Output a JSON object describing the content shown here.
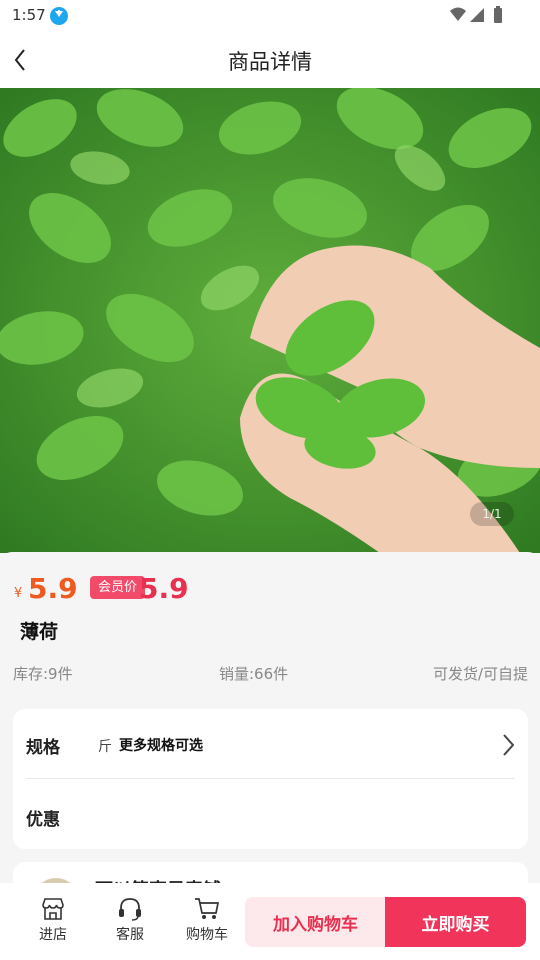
{
  "status_bar": {
    "time": "1:57",
    "download_icon": "download-icon"
  },
  "nav": {
    "title": "商品详情",
    "back_icon": "chevron-left-icon"
  },
  "hero": {
    "image": "mint-leaves-photo",
    "counter": "1/1"
  },
  "product": {
    "currency": "¥",
    "price": "5.9",
    "vip_badge": "会员价",
    "vip_price": "5.9",
    "name": "薄荷"
  },
  "stats": {
    "stock": "库存:9件",
    "sales": "销量:66件",
    "delivery": "可发货/可自提"
  },
  "spec": {
    "label": "规格",
    "unit": "斤",
    "more": "更多规格可选",
    "promo_label": "优惠"
  },
  "shop": {
    "name": "可以简直是表铺"
  },
  "bottom": {
    "tabs": [
      {
        "label": "进店",
        "icon": "store-icon"
      },
      {
        "label": "客服",
        "icon": "headset-icon"
      },
      {
        "label": "购物车",
        "icon": "cart-icon"
      }
    ],
    "add_cart": "加入购物车",
    "buy_now": "立即购买"
  },
  "colors": {
    "price": "#ee5a1f",
    "vip": "#e8304f",
    "accent": "#f0345a"
  }
}
